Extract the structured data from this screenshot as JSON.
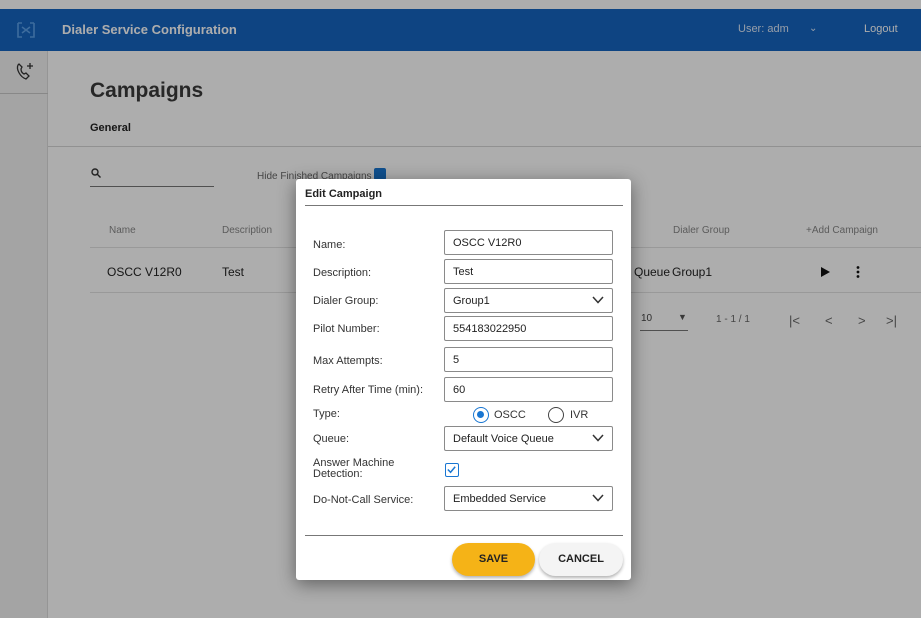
{
  "header": {
    "title": "Dialer Service Configuration",
    "user_label": "User:  adm",
    "logout_label": "Logout"
  },
  "page": {
    "title": "Campaigns",
    "tab_general": "General",
    "hide_finished_label": "Hide Finished Campaigns",
    "columns": {
      "name": "Name",
      "description": "Description",
      "dialer_group": "Dialer Group",
      "add_campaign": "+Add Campaign"
    },
    "rows": [
      {
        "name": "OSCC V12R0",
        "description": "Test",
        "queue_tail": "Queue",
        "dialer_group": "Group1"
      }
    ],
    "pager": {
      "rows_per_page": "10",
      "range": "1 - 1 / 1"
    }
  },
  "dialog": {
    "title": "Edit Campaign",
    "fields": {
      "name": {
        "label": "Name:",
        "value": "OSCC V12R0"
      },
      "description": {
        "label": "Description:",
        "value": "Test"
      },
      "dialer_group": {
        "label": "Dialer Group:",
        "value": "Group1"
      },
      "pilot_number": {
        "label": "Pilot Number:",
        "value": "554183022950"
      },
      "max_attempts": {
        "label": "Max Attempts:",
        "value": "5"
      },
      "retry_after": {
        "label": "Retry After Time (min):",
        "value": "60"
      },
      "type": {
        "label": "Type:",
        "options": [
          "OSCC",
          "IVR"
        ],
        "selected": "OSCC"
      },
      "queue": {
        "label": "Queue:",
        "value": "Default Voice Queue"
      },
      "amd": {
        "label_line1": "Answer Machine",
        "label_line2": "Detection:",
        "checked": true
      },
      "dnc": {
        "label": "Do-Not-Call Service:",
        "value": "Embedded Service"
      }
    },
    "save_label": "SAVE",
    "cancel_label": "CANCEL"
  },
  "colors": {
    "primary": "#1565c0",
    "accent": "#f5b317",
    "check": "#1976d2"
  }
}
